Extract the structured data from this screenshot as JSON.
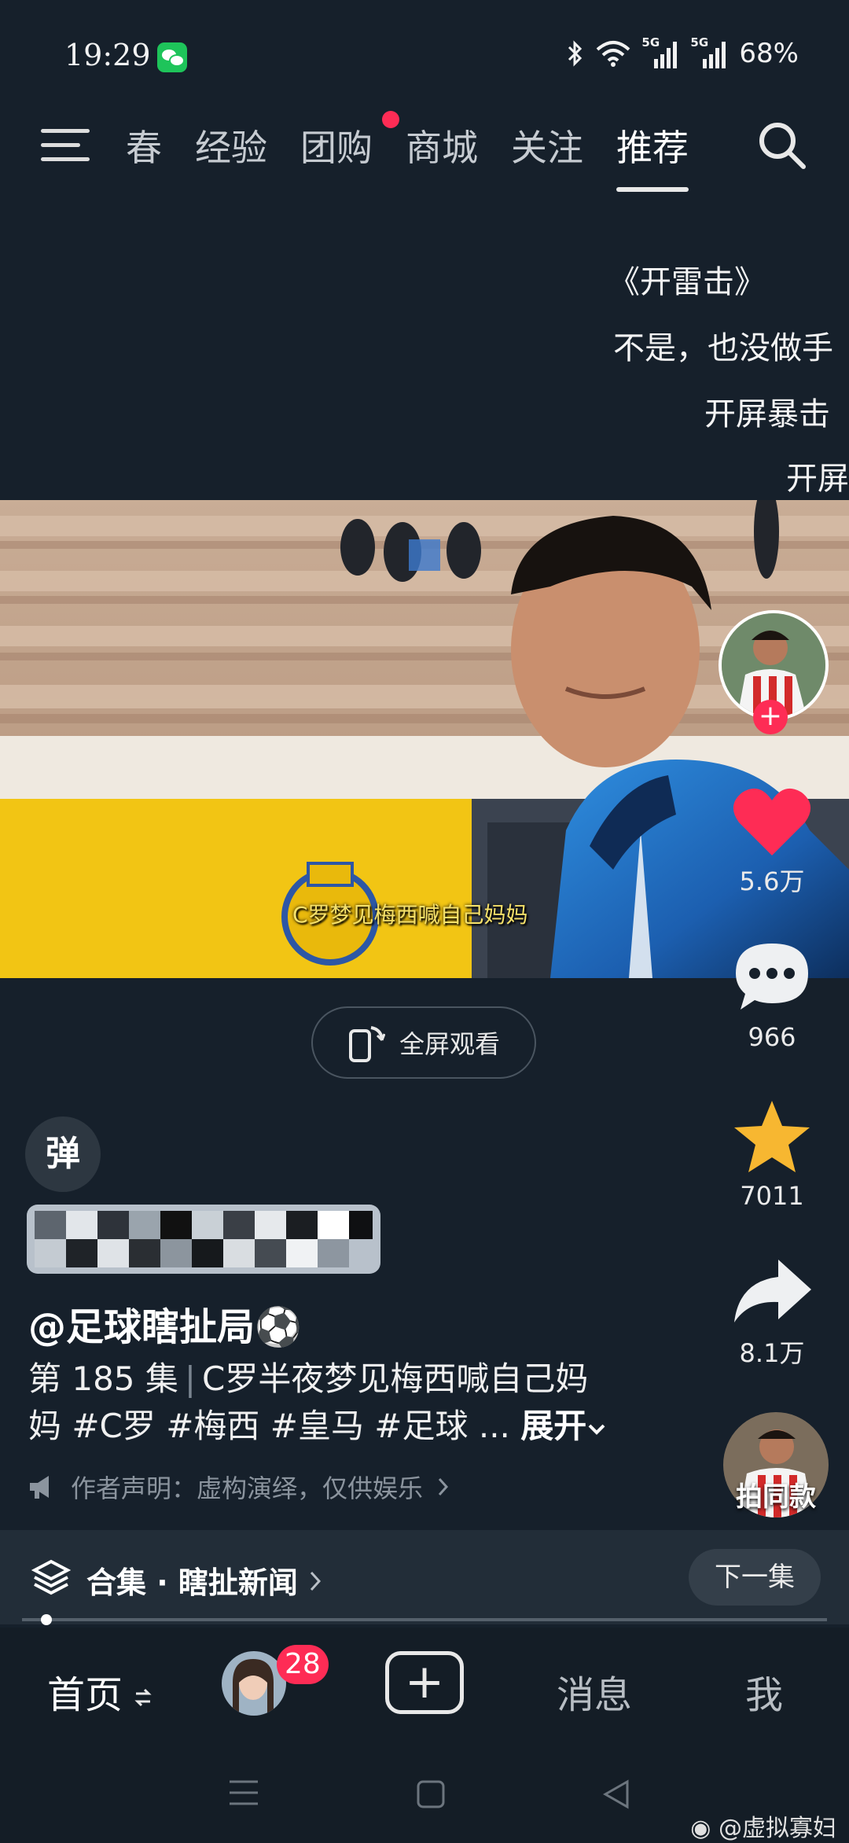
{
  "status_bar": {
    "time": "19:29",
    "battery": "68%",
    "sim1_label": "5G",
    "sim2_label": "5G",
    "icons": [
      "wechat-icon",
      "bluetooth-icon",
      "wifi-icon",
      "signal-icon",
      "signal-icon"
    ]
  },
  "top_nav": {
    "partial_tab": "青春",
    "tabs": [
      {
        "label": "春",
        "active": false
      },
      {
        "label": "经验",
        "active": false
      },
      {
        "label": "团购",
        "active": false,
        "dot": true
      },
      {
        "label": "商城",
        "active": false
      },
      {
        "label": "关注",
        "active": false
      },
      {
        "label": "推荐",
        "active": true
      }
    ]
  },
  "danmaku": [
    "《开雷击》",
    "不是，也没做手",
    "开屏暴击",
    "开屏"
  ],
  "video": {
    "subtitle": "C罗梦见梅西喊自己妈妈"
  },
  "actions": {
    "likes": "5.6万",
    "comments": "966",
    "favorites": "7011",
    "shares": "8.1万"
  },
  "fullscreen_label": "全屏观看",
  "danmu_toggle_label": "弹",
  "post": {
    "author": "@足球瞎扯局⚽",
    "episode": "第 185 集",
    "title_line1": "C罗半夜梦见梅西喊自己妈",
    "title_line2": "妈 #C罗 #梅西 #皇马 #足球 ...",
    "expand_label": "展开",
    "disclaimer": "作者声明：虚构演绎，仅供娱乐"
  },
  "same_style_label": "拍同款",
  "collection": {
    "label": "合集 · 瞎扯新闻",
    "next_label": "下一集",
    "progress": 0.03
  },
  "bottom_nav": {
    "home": "首页",
    "badge": "28",
    "messages": "消息",
    "me": "我"
  },
  "watermark": "@虚拟寡妇",
  "colors": {
    "background": "#16202b",
    "accent": "#fe2c55",
    "star": "#f7b731"
  }
}
